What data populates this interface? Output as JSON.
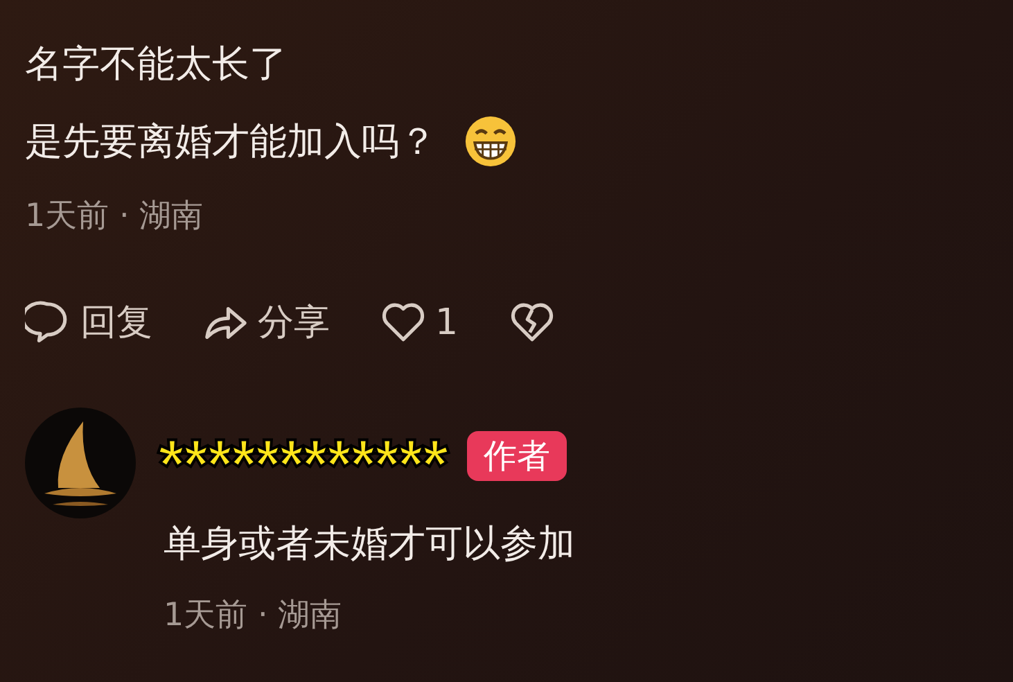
{
  "comment": {
    "lines": [
      "名字不能太长了",
      "是先要离婚才能加入吗？"
    ],
    "meta": "1天前 · 湖南",
    "actions": [
      {
        "kind": "reply",
        "label": "回复"
      },
      {
        "kind": "share",
        "label": "分享"
      },
      {
        "kind": "like",
        "label": "1"
      },
      {
        "kind": "dislike"
      }
    ]
  },
  "reply": {
    "name": "************",
    "badge": "作者",
    "text": "单身或者未婚才可以参加",
    "meta": "1天前 · 湖南"
  }
}
